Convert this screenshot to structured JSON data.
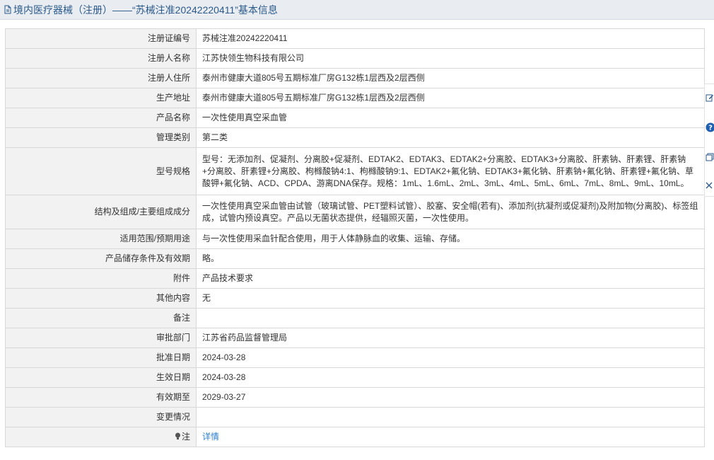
{
  "header": {
    "title": "境内医疗器械（注册）——“苏械注准20242220411”基本信息"
  },
  "rows": [
    {
      "label": "注册证编号",
      "value": "苏械注准20242220411"
    },
    {
      "label": "注册人名称",
      "value": "江苏快领生物科技有限公司"
    },
    {
      "label": "注册人住所",
      "value": "泰州市健康大道805号五期标准厂房G132栋1层西及2层西侧"
    },
    {
      "label": "生产地址",
      "value": "泰州市健康大道805号五期标准厂房G132栋1层西及2层西侧"
    },
    {
      "label": "产品名称",
      "value": "一次性使用真空采血管"
    },
    {
      "label": "管理类别",
      "value": "第二类"
    },
    {
      "label": "型号规格",
      "value": "型号：无添加剂、促凝剂、分离胶+促凝剂、EDTAK2、EDTAK3、EDTAK2+分离胶、EDTAK3+分离胶、肝素钠、肝素锂、肝素钠+分离胶、肝素锂+分离胶、枸橼酸钠4:1、枸橼酸钠9:1、EDTAK2+氟化钠、EDTAK3+氟化钠、肝素钠+氟化钠、肝素锂+氟化钠、草酸钾+氟化钠、ACD、CPDA、游离DNA保存。规格：1mL、1.6mL、2mL、3mL、4mL、5mL、6mL、7mL、8mL、9mL、10mL。"
    },
    {
      "label": "结构及组成/主要组成成分",
      "value": "一次性使用真空采血管由试管（玻璃试管、PET塑料试管）、胶塞、安全帽(若有)、添加剂(抗凝剂或促凝剂)及附加物(分离胶)、标签组成，试管内预设真空。产品以无菌状态提供，经辐照灭菌，一次性使用。"
    },
    {
      "label": "适用范围/预期用途",
      "value": "与一次性使用采血针配合使用，用于人体静脉血的收集、运输、存储。"
    },
    {
      "label": "产品储存条件及有效期",
      "value": "略。"
    },
    {
      "label": "附件",
      "value": "产品技术要求"
    },
    {
      "label": "其他内容",
      "value": "无"
    },
    {
      "label": "备注",
      "value": ""
    },
    {
      "label": "审批部门",
      "value": "江苏省药品监督管理局"
    },
    {
      "label": "批准日期",
      "value": "2024-03-28"
    },
    {
      "label": "生效日期",
      "value": "2024-03-28"
    },
    {
      "label": "有效期至",
      "value": "2029-03-27"
    },
    {
      "label": "变更情况",
      "value": ""
    }
  ],
  "note": {
    "label": "注",
    "link_text": "详情"
  },
  "icons": {
    "header": "document-icon",
    "note": "lightbulb-icon",
    "side": [
      "edit-icon",
      "help-icon",
      "copy-icon",
      "close-icon"
    ]
  },
  "colors": {
    "link": "#2d7fd1",
    "header_text": "#2b5a8a",
    "help_badge": "#1f5fb0"
  }
}
